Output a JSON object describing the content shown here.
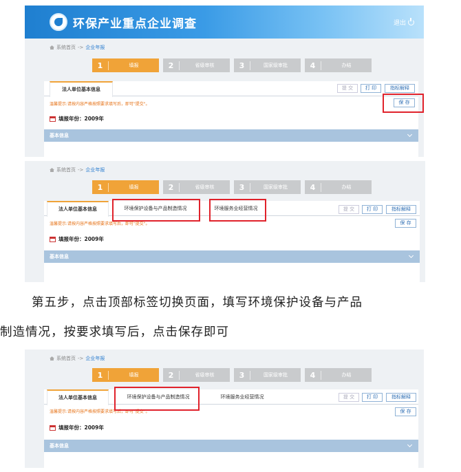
{
  "header": {
    "site_title": "环保产业重点企业调查",
    "logout": "退出"
  },
  "breadcrumb": {
    "home": "系统首页",
    "sep": "->",
    "current": "企业年报"
  },
  "steps": [
    {
      "num": "1",
      "label": "填报"
    },
    {
      "num": "2",
      "label": "省级审核"
    },
    {
      "num": "3",
      "label": "国家级审批"
    },
    {
      "num": "4",
      "label": "办结"
    }
  ],
  "tabs": {
    "basic": "法人单位基本信息",
    "equipment": "环境保护设备与产品制造情况",
    "service": "环境服务业经营情况"
  },
  "buttons": {
    "submit": "提 交",
    "print": "打 印",
    "explain": "指标解释",
    "save": "保 存"
  },
  "notice": "温馨提示:请按内容严格按照要求填写后，即可\"提交\"。",
  "year_label": "填报年份：2009年",
  "section": "基本信息",
  "caption": {
    "line1": "第五步，点击顶部标签切换页面，填写环境保护设备与产品",
    "line2": "制造情况，按要求填写后，点击保存即可"
  }
}
